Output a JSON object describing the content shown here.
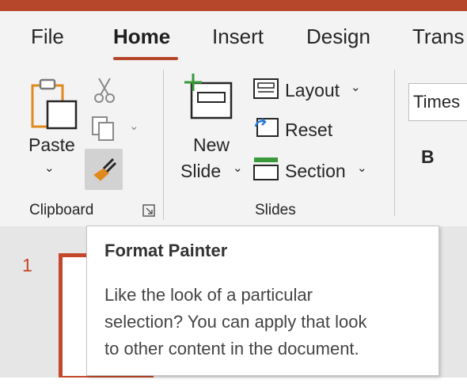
{
  "tabs": [
    {
      "label": "File",
      "active": false
    },
    {
      "label": "Home",
      "active": true
    },
    {
      "label": "Insert",
      "active": false
    },
    {
      "label": "Design",
      "active": false
    },
    {
      "label": "Trans",
      "active": false
    }
  ],
  "clipboard": {
    "paste_label": "Paste",
    "group_label": "Clipboard",
    "cut_icon": "scissors-icon",
    "copy_icon": "copy-icon",
    "format_painter_icon": "paintbrush-icon",
    "launcher_icon": "dialog-launcher-icon"
  },
  "slides": {
    "new_slide_line1": "New",
    "new_slide_line2": "Slide",
    "layout_label": "Layout",
    "reset_label": "Reset",
    "section_label": "Section",
    "group_label": "Slides"
  },
  "font": {
    "name_value": "Times",
    "bold_label": "B"
  },
  "slide_pane": {
    "slide_number": "1"
  },
  "tooltip": {
    "title": "Format Painter",
    "body_lines": [
      "Like the look of a particular",
      "selection? You can apply that look",
      "to other content in the document."
    ]
  },
  "colors": {
    "accent": "#b7472a",
    "ribbon_bg": "#f3f3f3",
    "pane_bg": "#e6e6e6"
  }
}
